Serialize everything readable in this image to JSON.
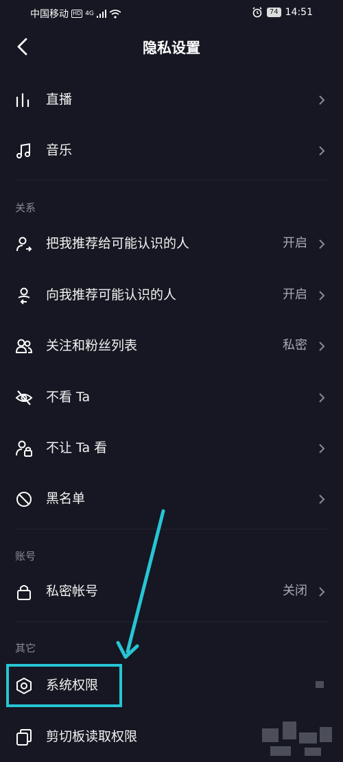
{
  "status": {
    "carrier": "中国移动",
    "hd": "HD",
    "network": "4G",
    "battery": "74",
    "time": "14:51"
  },
  "header": {
    "title": "隐私设置"
  },
  "rows_top": [
    {
      "label": "直播",
      "icon": "bar-chart-icon"
    },
    {
      "label": "音乐",
      "icon": "music-note-icon"
    }
  ],
  "sections": {
    "relations": "关系",
    "account": "账号",
    "other": "其它"
  },
  "relations_rows": [
    {
      "label": "把我推荐给可能认识的人",
      "value": "开启",
      "icon": "person-share-icon"
    },
    {
      "label": "向我推荐可能认识的人",
      "value": "开启",
      "icon": "person-recommend-icon"
    },
    {
      "label": "关注和粉丝列表",
      "value": "私密",
      "icon": "people-icon"
    },
    {
      "label": "不看 Ta",
      "value": "",
      "icon": "eye-off-icon"
    },
    {
      "label": "不让 Ta 看",
      "value": "",
      "icon": "person-lock-icon"
    },
    {
      "label": "黑名单",
      "value": "",
      "icon": "block-icon"
    }
  ],
  "account_rows": [
    {
      "label": "私密帐号",
      "value": "关闭",
      "icon": "lock-icon"
    }
  ],
  "other_rows": [
    {
      "label": "系统权限",
      "icon": "hexagon-settings-icon"
    },
    {
      "label": "剪切板读取权限",
      "icon": "clipboard-icon"
    }
  ],
  "colors": {
    "background": "#161722",
    "highlight": "#27c5d4",
    "muted": "#a9aab2"
  }
}
